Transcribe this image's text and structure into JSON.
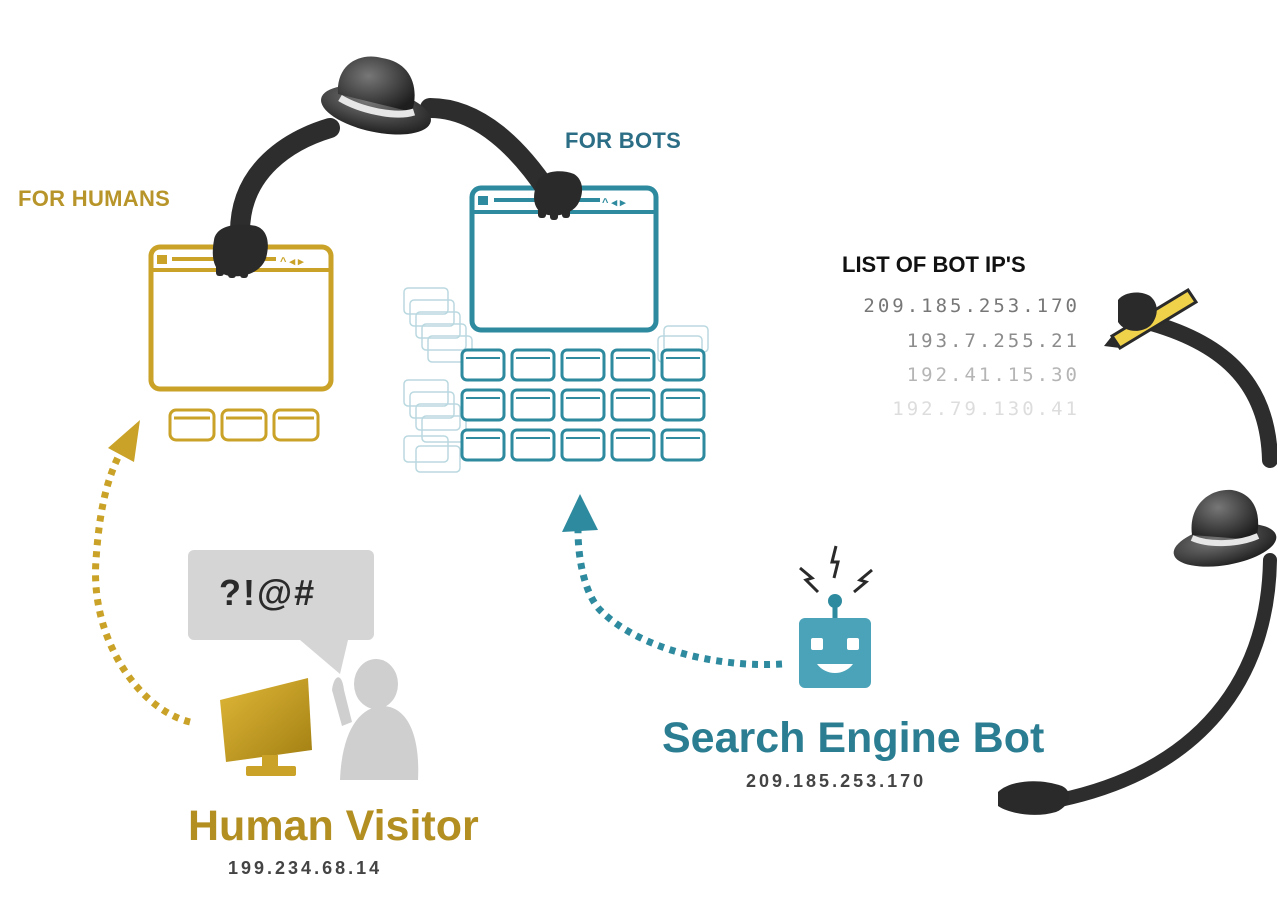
{
  "labels": {
    "for_humans": "FOR HUMANS",
    "for_bots": "FOR BOTS",
    "bot_ip_list_title": "LIST OF BOT IP'S"
  },
  "bot_ip_list": [
    "209.185.253.170",
    "193.7.255.21",
    "192.41.15.30",
    "192.79.130.41"
  ],
  "speech_bubble": "?!@#",
  "human_visitor": {
    "name": "Human Visitor",
    "ip": "199.234.68.14"
  },
  "search_engine_bot": {
    "name": "Search Engine Bot",
    "ip": "209.185.253.170"
  },
  "colors": {
    "human": "#c9a227",
    "bot": "#2e8a9e",
    "hat": "#2d2d2d",
    "hand": "#2a2a2a"
  },
  "icons": [
    "top-hat-icon",
    "gloved-hand-icon",
    "browser-window-icon",
    "monitor-icon",
    "person-icon",
    "robot-icon",
    "pencil-icon",
    "speech-bubble-icon"
  ]
}
